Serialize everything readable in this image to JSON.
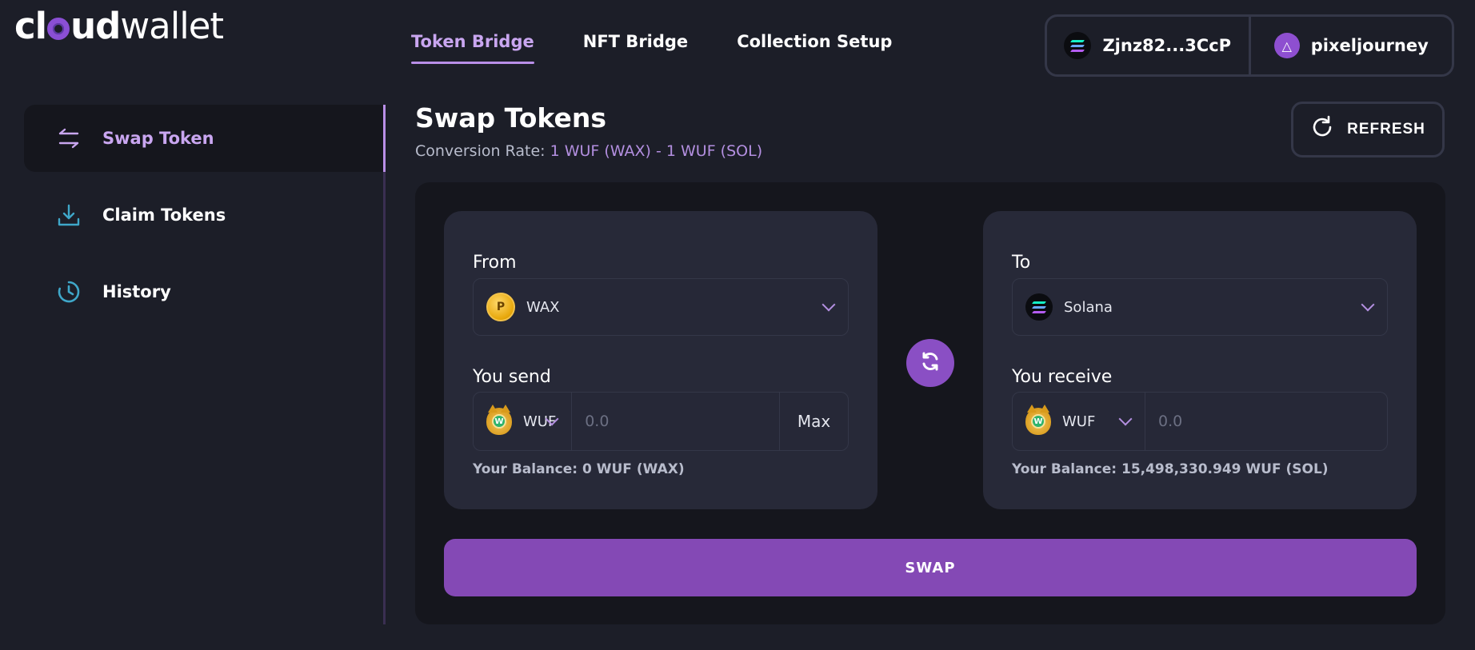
{
  "brand": {
    "logo_part1": "cl",
    "logo_part2": "ud",
    "logo_part3": "wallet"
  },
  "topnav": {
    "tabs": [
      {
        "label": "Token Bridge",
        "active": true
      },
      {
        "label": "NFT Bridge",
        "active": false
      },
      {
        "label": "Collection Setup",
        "active": false
      }
    ]
  },
  "wallets": {
    "solana_address": "Zjnz82...3CcP",
    "wax_account": "pixeljourney"
  },
  "sidebar": {
    "items": [
      {
        "label": "Swap Token",
        "icon": "swap-arrows-icon",
        "active": true
      },
      {
        "label": "Claim Tokens",
        "icon": "download-icon",
        "active": false
      },
      {
        "label": "History",
        "icon": "history-clock-icon",
        "active": false
      }
    ]
  },
  "main": {
    "title": "Swap Tokens",
    "rate_label": "Conversion Rate:",
    "rate_value": "1 WUF (WAX) - 1 WUF (SOL)",
    "refresh_label": "REFRESH",
    "from": {
      "heading": "From",
      "chain": "WAX",
      "send_label": "You send",
      "token": "WUF",
      "amount_placeholder": "0.0",
      "max_label": "Max",
      "balance": "Your Balance: 0 WUF (WAX)"
    },
    "to": {
      "heading": "To",
      "chain": "Solana",
      "receive_label": "You receive",
      "token": "WUF",
      "amount_placeholder": "0.0",
      "balance": "Your Balance: 15,498,330.949 WUF (SOL)"
    },
    "swap_label": "SWAP"
  },
  "colors": {
    "background": "#1c1e28",
    "panel": "#15161d",
    "card": "#272938",
    "accent": "#8449b5",
    "accent_light": "#c9a6f0"
  }
}
